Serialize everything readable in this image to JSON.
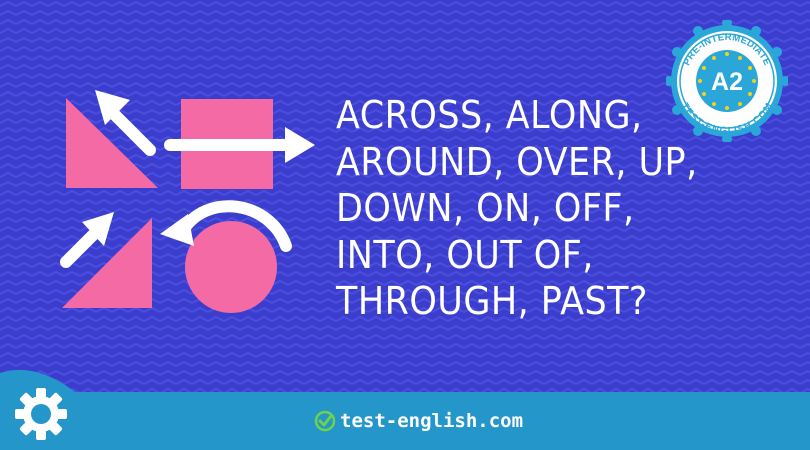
{
  "headline_lines": [
    "ACROSS, ALONG,",
    "AROUND, OVER, UP,",
    "DOWN, ON, OFF,",
    "INTO, OUT OF,",
    "THROUGH, PAST?"
  ],
  "badge": {
    "top_text": "PRE-INTERMEDIATE",
    "level": "A2",
    "bottom_text": "TEST-ENGLISH.COM"
  },
  "footer": {
    "brand": "test-english.com"
  },
  "icons": [
    "settings-gear-icon",
    "checkmark-icon",
    "arrow-up-left-icon",
    "arrow-right-icon",
    "arrow-up-right-icon",
    "curved-arrow-icon"
  ],
  "colors": {
    "background": "#3b3dcc",
    "shape": "#f46aa5",
    "footer": "#2596c9",
    "badge": "#2aa7d8",
    "accent_green": "#6fd24a"
  }
}
